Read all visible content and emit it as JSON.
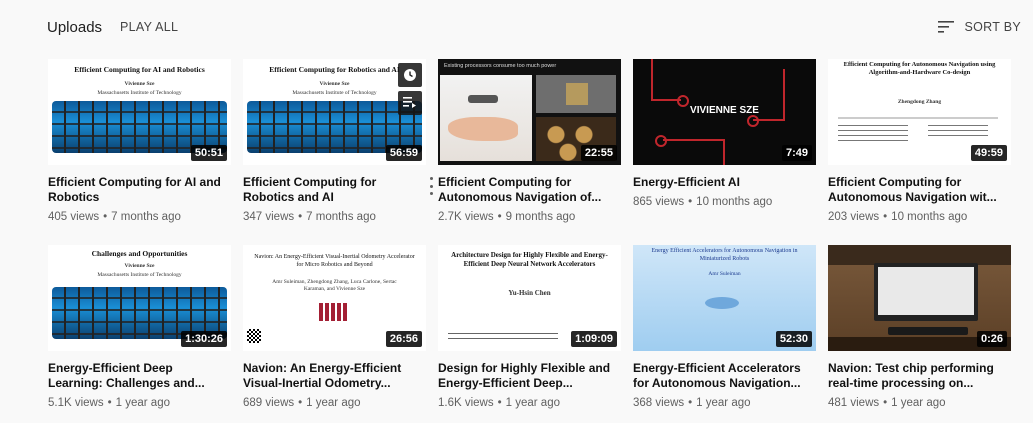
{
  "header": {
    "title": "Uploads",
    "play_all": "PLAY ALL",
    "sort_by": "SORT BY"
  },
  "videos": [
    {
      "title": "Efficient Computing for AI and Robotics",
      "views": "405 views",
      "age": "7 months ago",
      "duration": "50:51",
      "thumb_heading": "Efficient Computing for AI and Robotics",
      "thumb_name": "Vivienne Sze",
      "thumb_affil": "Massachusetts Institute of Technology"
    },
    {
      "title": "Efficient Computing for Robotics and AI",
      "views": "347 views",
      "age": "7 months ago",
      "duration": "56:59",
      "thumb_heading": "Efficient Computing for Robotics and AI",
      "thumb_name": "Vivienne Sze",
      "thumb_affil": "Massachusetts Institute of Technology"
    },
    {
      "title": "Efficient Computing for Autonomous Navigation of...",
      "views": "2.7K views",
      "age": "9 months ago",
      "duration": "22:55",
      "thumb_heading": "Existing processors consume too much power"
    },
    {
      "title": "Energy-Efficient AI",
      "views": "865 views",
      "age": "10 months ago",
      "duration": "7:49",
      "thumb_heading": "VIVIENNE SZE"
    },
    {
      "title": "Efficient Computing for Autonomous Navigation wit...",
      "views": "203 views",
      "age": "10 months ago",
      "duration": "49:59",
      "thumb_heading": "Efficient Computing for Autonomous Navigation using Algorithm-and-Hardware Co-design",
      "thumb_name": "Zhengdong Zhang"
    },
    {
      "title": "Energy-Efficient Deep Learning: Challenges and...",
      "views": "5.1K views",
      "age": "1 year ago",
      "duration": "1:30:26",
      "thumb_heading": "Challenges and Opportunities",
      "thumb_name": "Vivienne Sze",
      "thumb_affil": "Massachusetts Institute of Technology"
    },
    {
      "title": "Navion: An Energy-Efficient Visual-Inertial Odometry...",
      "views": "689 views",
      "age": "1 year ago",
      "duration": "26:56",
      "thumb_heading": "Navion: An Energy-Efficient Visual-Inertial Odometry Accelerator for Micro Robotics and Beyond",
      "thumb_name": "Amr Suleiman, Zhengdong Zhang, Luca Carlone, Sertac Karaman, and Vivienne Sze"
    },
    {
      "title": "Design for Highly Flexible and Energy-Efficient Deep...",
      "views": "1.6K views",
      "age": "1 year ago",
      "duration": "1:09:09",
      "thumb_heading": "Architecture Design for Highly Flexible and Energy-Efficient Deep Neural Network Accelerators",
      "thumb_name": "Yu-Hsin Chen"
    },
    {
      "title": "Energy-Efficient Accelerators for Autonomous Navigation...",
      "views": "368 views",
      "age": "1 year ago",
      "duration": "52:30",
      "thumb_heading": "Energy Efficient Accelerators for Autonomous Navigation in Miniaturized Robots",
      "thumb_name": "Amr Suleiman"
    },
    {
      "title": "Navion: Test chip performing real-time processing on...",
      "views": "481 views",
      "age": "1 year ago",
      "duration": "0:26"
    }
  ],
  "icons": {
    "sort": "sort-lines-icon",
    "watch_later": "clock-icon",
    "add_to_queue": "queue-icon",
    "more": "more-vertical-icon"
  },
  "colors": {
    "background": "#f9f9f9",
    "title_text": "#111111",
    "meta_text": "#606060",
    "duration_badge": "#000000"
  }
}
